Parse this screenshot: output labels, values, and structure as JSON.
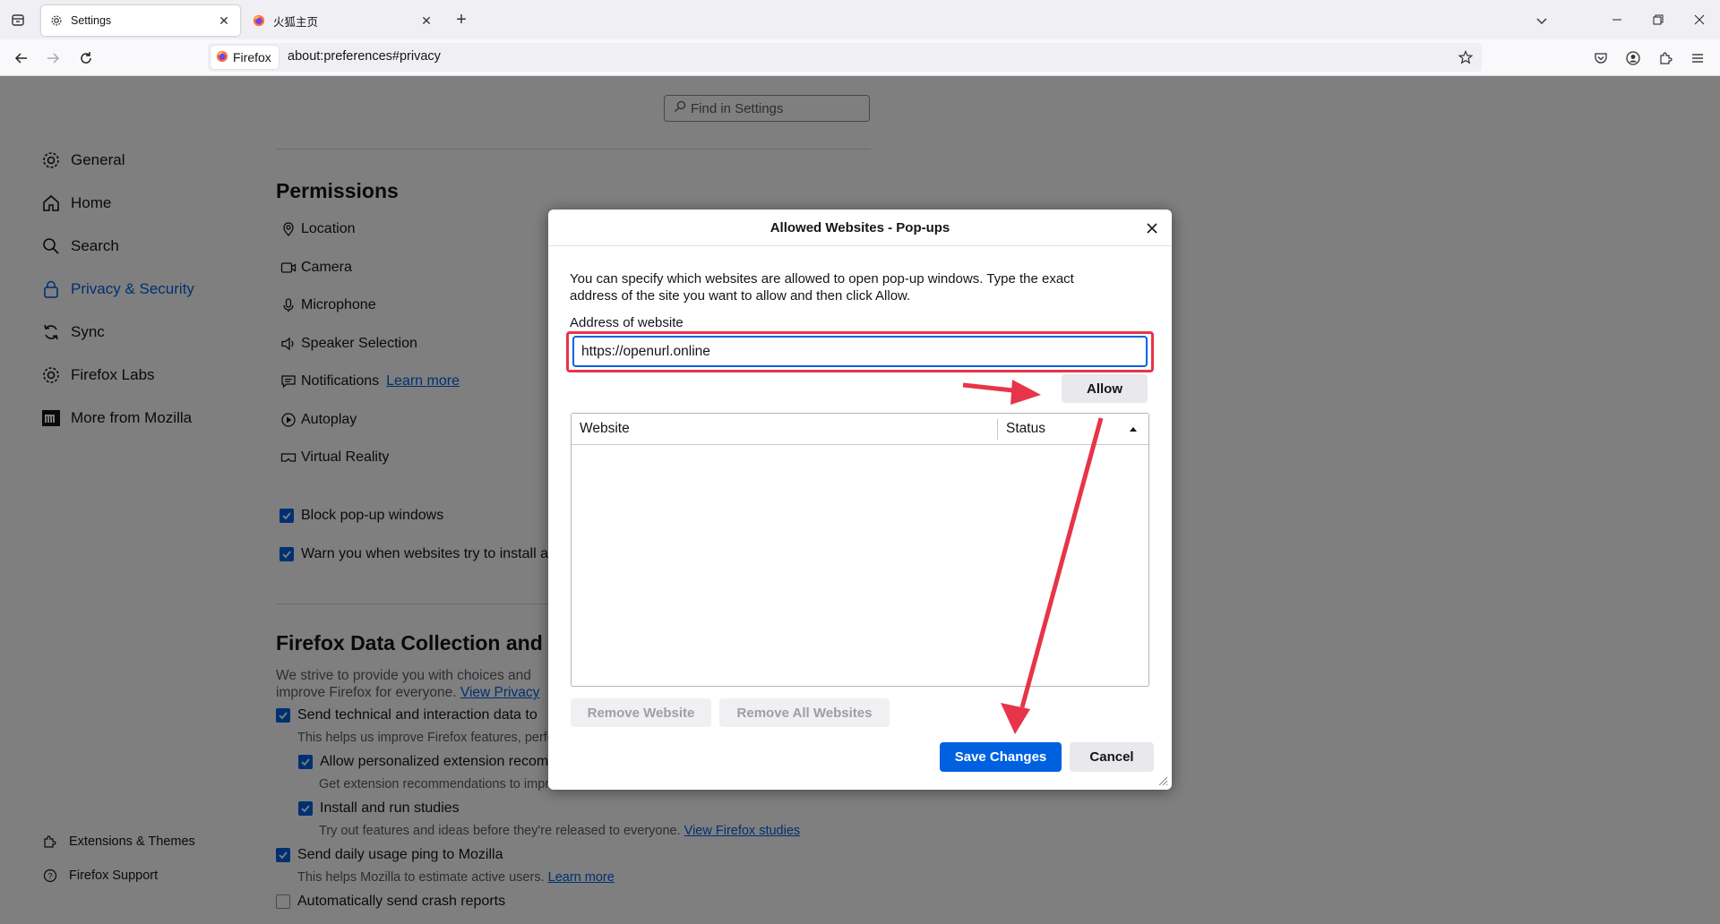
{
  "tabs": [
    {
      "title": "Settings",
      "icon": "gear-icon"
    },
    {
      "title": "火狐主页",
      "icon": "firefox-icon"
    }
  ],
  "navbar": {
    "identity_label": "Firefox",
    "url": "about:preferences#privacy"
  },
  "search": {
    "placeholder": "Find in Settings"
  },
  "sidebar": {
    "items": [
      {
        "label": "General",
        "icon": "gear-icon"
      },
      {
        "label": "Home",
        "icon": "home-icon"
      },
      {
        "label": "Search",
        "icon": "search-icon"
      },
      {
        "label": "Privacy & Security",
        "icon": "lock-icon",
        "selected": true
      },
      {
        "label": "Sync",
        "icon": "sync-icon"
      },
      {
        "label": "Firefox Labs",
        "icon": "labs-icon"
      },
      {
        "label": "More from Mozilla",
        "icon": "mozilla-icon"
      }
    ],
    "footer": [
      {
        "label": "Extensions & Themes",
        "icon": "puzzle-icon"
      },
      {
        "label": "Firefox Support",
        "icon": "help-icon"
      }
    ]
  },
  "permissions": {
    "heading": "Permissions",
    "items": [
      {
        "label": "Location",
        "icon": "location-icon"
      },
      {
        "label": "Camera",
        "icon": "camera-icon"
      },
      {
        "label": "Microphone",
        "icon": "microphone-icon"
      },
      {
        "label": "Speaker Selection",
        "icon": "speaker-icon"
      },
      {
        "label": "Notifications",
        "icon": "notification-icon"
      },
      {
        "label": "Autoplay",
        "icon": "autoplay-icon"
      },
      {
        "label": "Virtual Reality",
        "icon": "vr-icon"
      }
    ],
    "notifications_link": "Learn more",
    "block_popups": "Block pop-up windows",
    "warn_addons": "Warn you when websites try to install a"
  },
  "data_collection": {
    "heading": "Firefox Data Collection and",
    "intro_line1": "We strive to provide you with choices and",
    "intro_line2": "improve Firefox for everyone.",
    "intro_link": "View Privacy",
    "send_technical": "Send technical and interaction data to",
    "send_technical_desc": "This helps us improve Firefox features, perfo",
    "personalized_ext": "Allow personalized extension recom",
    "personalized_ext_desc": "Get extension recommendations to impro",
    "studies": "Install and run studies",
    "studies_desc": "Try out features and ideas before they're released to everyone.",
    "studies_link": "View Firefox studies",
    "usage_ping": "Send daily usage ping to Mozilla",
    "usage_ping_desc": "This helps Mozilla to estimate active users.",
    "usage_ping_link": "Learn more",
    "crash_reports": "Automatically send crash reports"
  },
  "dialog": {
    "title": "Allowed Websites - Pop-ups",
    "intro_line1": "You can specify which websites are allowed to open pop-up windows. Type the exact",
    "intro_line2": "address of the site you want to allow and then click Allow.",
    "address_label": "Address of website",
    "address_value": "https://openurl.online",
    "allow_button": "Allow",
    "column_website": "Website",
    "column_status": "Status",
    "remove_website": "Remove Website",
    "remove_all": "Remove All Websites",
    "save_changes": "Save Changes",
    "cancel": "Cancel"
  },
  "colors": {
    "accent": "#0061e0",
    "annotation": "#e63548"
  }
}
